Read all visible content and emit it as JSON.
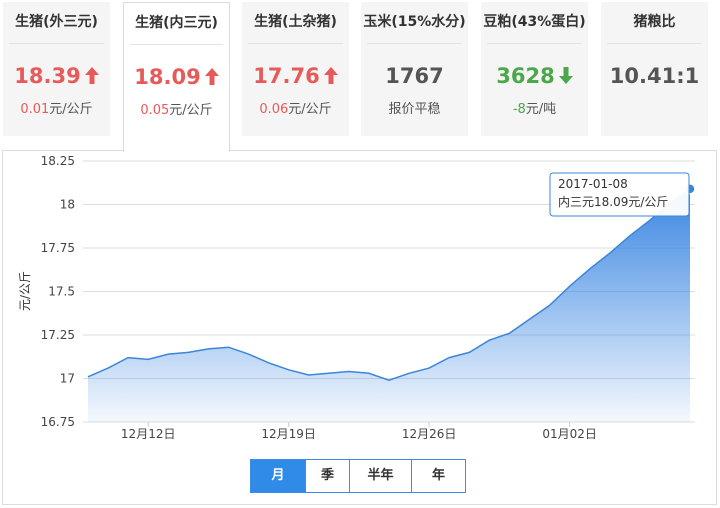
{
  "cards": [
    {
      "title": "生猪(外三元)",
      "value": "18.39",
      "trend": "up",
      "change_num": "0.01",
      "change_unit": "元/公斤"
    },
    {
      "title": "生猪(内三元)",
      "value": "18.09",
      "trend": "up",
      "change_num": "0.05",
      "change_unit": "元/公斤"
    },
    {
      "title": "生猪(土杂猪)",
      "value": "17.76",
      "trend": "up",
      "change_num": "0.06",
      "change_unit": "元/公斤"
    },
    {
      "title": "玉米(15%水分)",
      "value": "1767",
      "trend": "flat",
      "change_num": "",
      "change_unit": "报价平稳"
    },
    {
      "title": "豆粕(43%蛋白)",
      "value": "3628",
      "trend": "down",
      "change_num": "-8",
      "change_unit": "元/吨"
    },
    {
      "title": "猪粮比",
      "value": "10.41:1",
      "trend": "flat",
      "change_num": "",
      "change_unit": ""
    }
  ],
  "colors": {
    "up": "#e65a5a",
    "down": "#4aa84a",
    "line": "#3b86d9",
    "accent": "#2f8ae8"
  },
  "tooltip": {
    "date": "2017-01-08",
    "text": "内三元18.09元/公斤"
  },
  "range_tabs": [
    "月",
    "季",
    "半年",
    "年"
  ],
  "chart_data": {
    "type": "area",
    "ylabel": "元/公斤",
    "ylim": [
      16.75,
      18.25
    ],
    "yticks": [
      "16.75",
      "17",
      "17.25",
      "17.5",
      "17.75",
      "18",
      "18.25"
    ],
    "xtick_labels": [
      "12月12日",
      "12月19日",
      "12月26日",
      "01月02日"
    ],
    "grid": true,
    "x": [
      "2016-12-09",
      "2016-12-10",
      "2016-12-11",
      "2016-12-12",
      "2016-12-13",
      "2016-12-14",
      "2016-12-15",
      "2016-12-16",
      "2016-12-17",
      "2016-12-18",
      "2016-12-19",
      "2016-12-20",
      "2016-12-21",
      "2016-12-22",
      "2016-12-23",
      "2016-12-24",
      "2016-12-25",
      "2016-12-26",
      "2016-12-27",
      "2016-12-28",
      "2016-12-29",
      "2016-12-30",
      "2016-12-31",
      "2017-01-01",
      "2017-01-02",
      "2017-01-03",
      "2017-01-04",
      "2017-01-05",
      "2017-01-06",
      "2017-01-07",
      "2017-01-08"
    ],
    "series": [
      {
        "name": "内三元",
        "values": [
          17.01,
          17.06,
          17.12,
          17.11,
          17.14,
          17.15,
          17.17,
          17.18,
          17.14,
          17.09,
          17.05,
          17.02,
          17.03,
          17.04,
          17.03,
          16.99,
          17.03,
          17.06,
          17.12,
          17.15,
          17.22,
          17.26,
          17.34,
          17.42,
          17.53,
          17.63,
          17.72,
          17.82,
          17.91,
          18.01,
          18.09
        ]
      }
    ]
  }
}
